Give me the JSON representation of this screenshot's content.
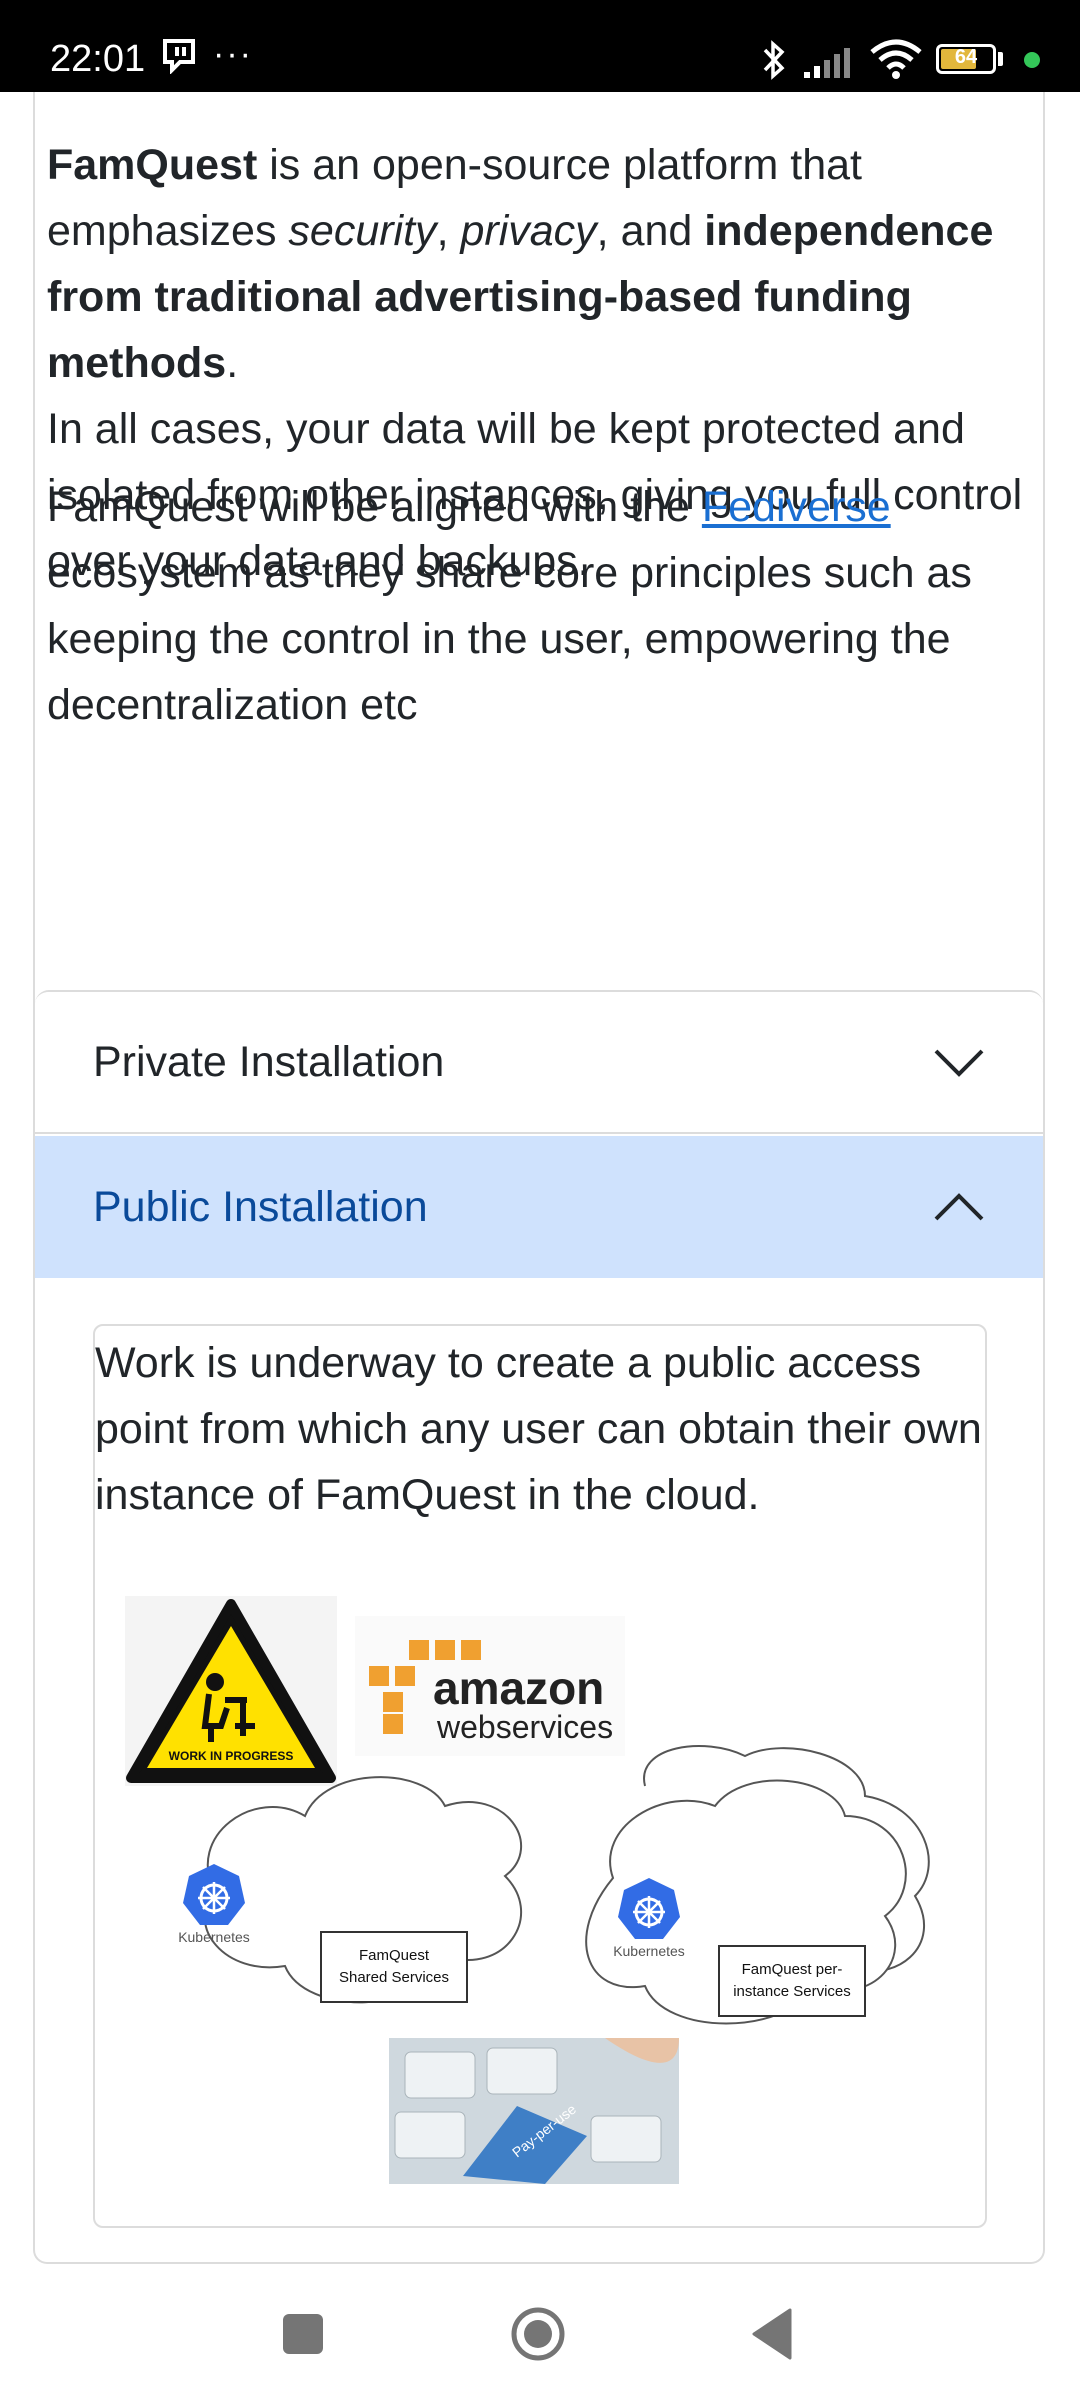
{
  "status_bar": {
    "time": "22:01",
    "more": "···",
    "battery": "64"
  },
  "content": {
    "para1": {
      "brand": "FamQuest",
      "t1": " is an open-source platform that emphasizes ",
      "em1": "security",
      "t2": ", ",
      "em2": "privacy",
      "t3": ", and ",
      "strong": "independence from traditional advertising-based funding methods",
      "t4": ".",
      "line2": "In all cases, your data will be kept protected and isolated from other instances, giving you full control over your data and backups."
    },
    "para2": {
      "t1": "FamQuest will be aligned with the ",
      "link": "Fediverse",
      "t2": " ecosystem as they share core principles such as keeping the control in the user, empowering the decentralization etc"
    }
  },
  "accordion": {
    "items": [
      {
        "label": "Private Installation",
        "expanded": false
      },
      {
        "label": "Public Installation",
        "expanded": true
      }
    ],
    "public_body": "Work is underway to create a public access point from which any user can obtain their own instance of FamQuest in the cloud."
  },
  "diagram": {
    "wip_label": "WORK IN PROGRESS",
    "amazon": "amazon",
    "web_services": "webservices",
    "k8s_label_1": "Kubernetes",
    "k8s_label_2": "Kubernetes",
    "shared_1": "FamQuest",
    "shared_2": "Shared Services",
    "perinst_1": "FamQuest per-",
    "perinst_2": "instance Services",
    "key_label": "Pay-per-use"
  },
  "colors": {
    "accent_bg": "#cfe2fd",
    "accent_text": "#0a4a9a",
    "link": "#1a6fd2"
  },
  "icons": [
    "notification-icon",
    "more-icon",
    "bluetooth-icon",
    "signal-icon",
    "wifi-icon",
    "battery-icon",
    "chevron-down-icon",
    "chevron-up-icon",
    "kubernetes-icon",
    "nav-recents-icon",
    "nav-home-icon",
    "nav-back-icon"
  ]
}
